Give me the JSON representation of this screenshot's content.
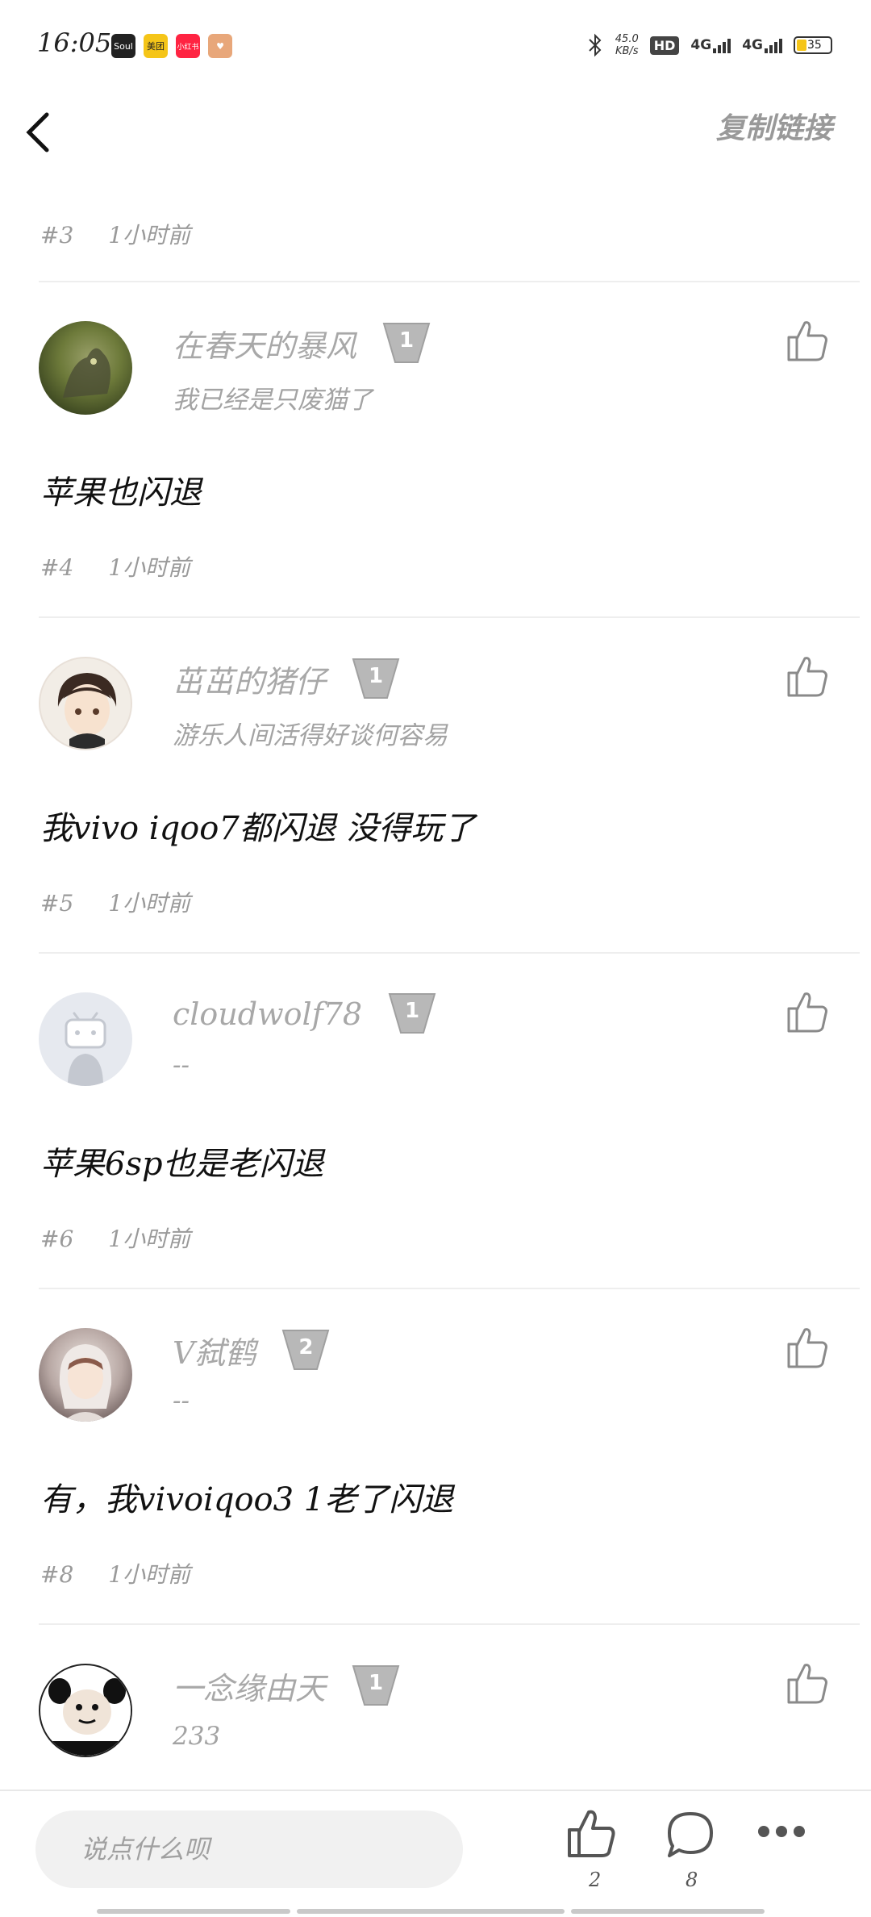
{
  "status": {
    "time": "16:05",
    "apps": [
      "Soul",
      "美团",
      "小红书",
      "♥"
    ],
    "speed_value": "45.0",
    "speed_unit": "KB/s",
    "hd": "HD",
    "network1": "4G",
    "network2": "4G",
    "battery": "35",
    "accent": "#f5c518"
  },
  "header": {
    "back_icon": "chevron-left-icon",
    "copy_link": "复制链接"
  },
  "top_meta": {
    "floor": "#3",
    "time": "1小时前"
  },
  "comments": [
    {
      "username": "在春天的暴风",
      "level": "1",
      "signature": "我已经是只废猫了",
      "text": "苹果也闪退",
      "floor": "#4",
      "time": "1小时前"
    },
    {
      "username": "茁茁的猪仔",
      "level": "1",
      "signature": "游乐人间活得好谈何容易",
      "text": "我vivo iqoo7都闪退 没得玩了",
      "floor": "#5",
      "time": "1小时前"
    },
    {
      "username": "cloudwolf78",
      "level": "1",
      "signature": "--",
      "text": "苹果6sp也是老闪退",
      "floor": "#6",
      "time": "1小时前"
    },
    {
      "username": "V弑鹤",
      "level": "2",
      "signature": "--",
      "text": "有，我vivoiqoo3 1老了闪退",
      "floor": "#8",
      "time": "1小时前"
    },
    {
      "username": "一念缘由天",
      "level": "1",
      "signature": "233",
      "text": "",
      "floor": "",
      "time": ""
    }
  ],
  "bottom": {
    "input_placeholder": "说点什么呗",
    "like_count": "2",
    "comment_count": "8"
  }
}
